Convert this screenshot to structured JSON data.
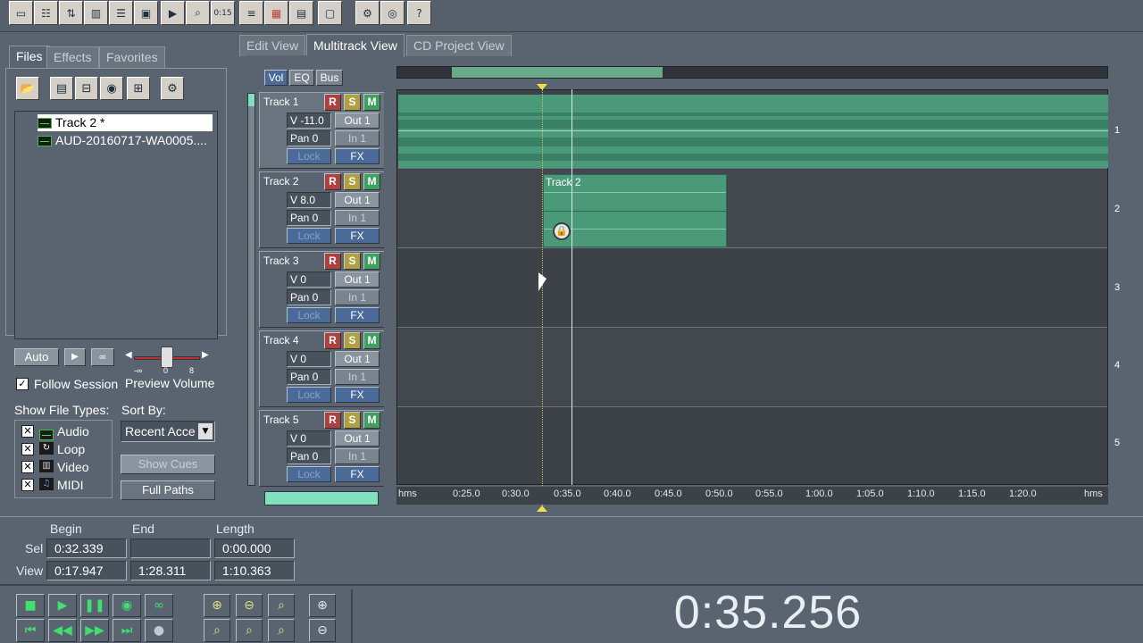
{
  "view_tabs": [
    "Edit View",
    "Multitrack View",
    "CD Project View"
  ],
  "left_tabs": [
    "Files",
    "Effects",
    "Favorites"
  ],
  "files": [
    {
      "name": "Track 2 *",
      "selected": true
    },
    {
      "name": "AUD-20160717-WA0005....",
      "selected": false
    }
  ],
  "preview": {
    "auto_label": "Auto",
    "follow_session": "Follow Session",
    "preview_volume": "Preview Volume",
    "scale_min": "-∞",
    "scale_mid": "0",
    "scale_max": "8"
  },
  "file_types": {
    "label": "Show File Types:",
    "items": [
      "Audio",
      "Loop",
      "Video",
      "MIDI"
    ]
  },
  "sort": {
    "label": "Sort By:",
    "value": "Recent Acce",
    "show_cues": "Show Cues",
    "full_paths": "Full Paths"
  },
  "header_tabs": [
    "Vol",
    "EQ",
    "Bus"
  ],
  "tracks": [
    {
      "name": "Track 1",
      "vol": "V -11.0",
      "pan": "Pan 0",
      "out": "Out 1",
      "in": "In 1",
      "lock": "Lock",
      "fx": "FX",
      "num": "1"
    },
    {
      "name": "Track 2",
      "vol": "V 8.0",
      "pan": "Pan 0",
      "out": "Out 1",
      "in": "In 1",
      "lock": "Lock",
      "fx": "FX",
      "num": "2"
    },
    {
      "name": "Track 3",
      "vol": "V 0",
      "pan": "Pan 0",
      "out": "Out 1",
      "in": "In 1",
      "lock": "Lock",
      "fx": "FX",
      "num": "3"
    },
    {
      "name": "Track 4",
      "vol": "V 0",
      "pan": "Pan 0",
      "out": "Out 1",
      "in": "In 1",
      "lock": "Lock",
      "fx": "FX",
      "num": "4"
    },
    {
      "name": "Track 5",
      "vol": "V 0",
      "pan": "Pan 0",
      "out": "Out 1",
      "in": "In 1",
      "lock": "Lock",
      "fx": "FX",
      "num": "5"
    }
  ],
  "rsm": {
    "r": "R",
    "s": "S",
    "m": "M"
  },
  "clip2_label": "Track 2",
  "ruler": [
    "hms",
    "0:25.0",
    "0:30.0",
    "0:35.0",
    "0:40.0",
    "0:45.0",
    "0:50.0",
    "0:55.0",
    "1:00.0",
    "1:05.0",
    "1:10.0",
    "1:15.0",
    "1:20.0",
    "hms"
  ],
  "selection": {
    "begin_label": "Begin",
    "end_label": "End",
    "length_label": "Length",
    "sel_label": "Sel",
    "view_label": "View",
    "sel_begin": "0:32.339",
    "sel_end": "",
    "sel_length": "0:00.000",
    "view_begin": "0:17.947",
    "view_end": "1:28.311",
    "view_length": "1:10.363"
  },
  "time_display": "0:35.256",
  "colors": {
    "background": "#5a6470",
    "clip": "#4a9a7a",
    "canvas": "#3c4248"
  }
}
